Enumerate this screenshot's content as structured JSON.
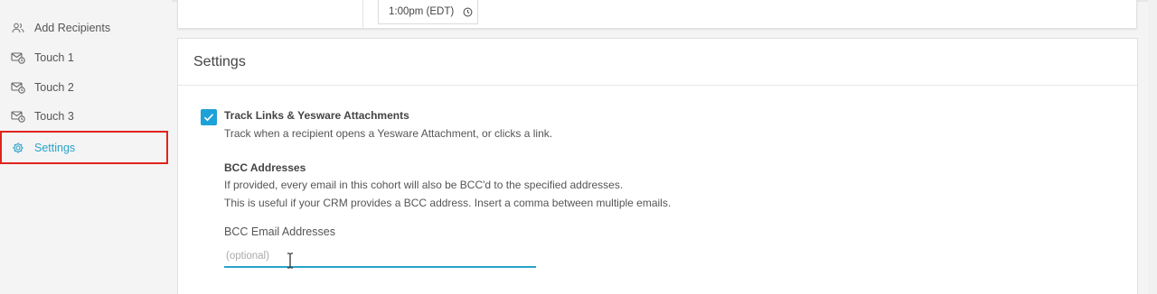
{
  "sidebar": {
    "items": [
      {
        "label": "Add Recipients",
        "icon": "users-icon"
      },
      {
        "label": "Touch 1",
        "icon": "mail-clock-icon"
      },
      {
        "label": "Touch 2",
        "icon": "mail-clock-icon"
      },
      {
        "label": "Touch 3",
        "icon": "mail-clock-icon"
      },
      {
        "label": "Settings",
        "icon": "gear-icon",
        "active": true
      }
    ]
  },
  "schedule": {
    "time": "1:00pm (EDT)"
  },
  "settings": {
    "title": "Settings",
    "track": {
      "checked": true,
      "label": "Track Links & Yesware Attachments",
      "description": "Track when a recipient opens a Yesware Attachment, or clicks a link."
    },
    "bcc": {
      "heading": "BCC Addresses",
      "line1": "If provided, every email in this cohort will also be BCC'd to the specified addresses.",
      "line2": "This is useful if your CRM provides a BCC address. Insert a comma between multiple emails.",
      "field_label": "BCC Email Addresses",
      "placeholder": "(optional)",
      "value": ""
    }
  },
  "colors": {
    "accent": "#2aa3c9",
    "checkbox": "#1da1d6",
    "highlight_border": "#e0231c"
  }
}
